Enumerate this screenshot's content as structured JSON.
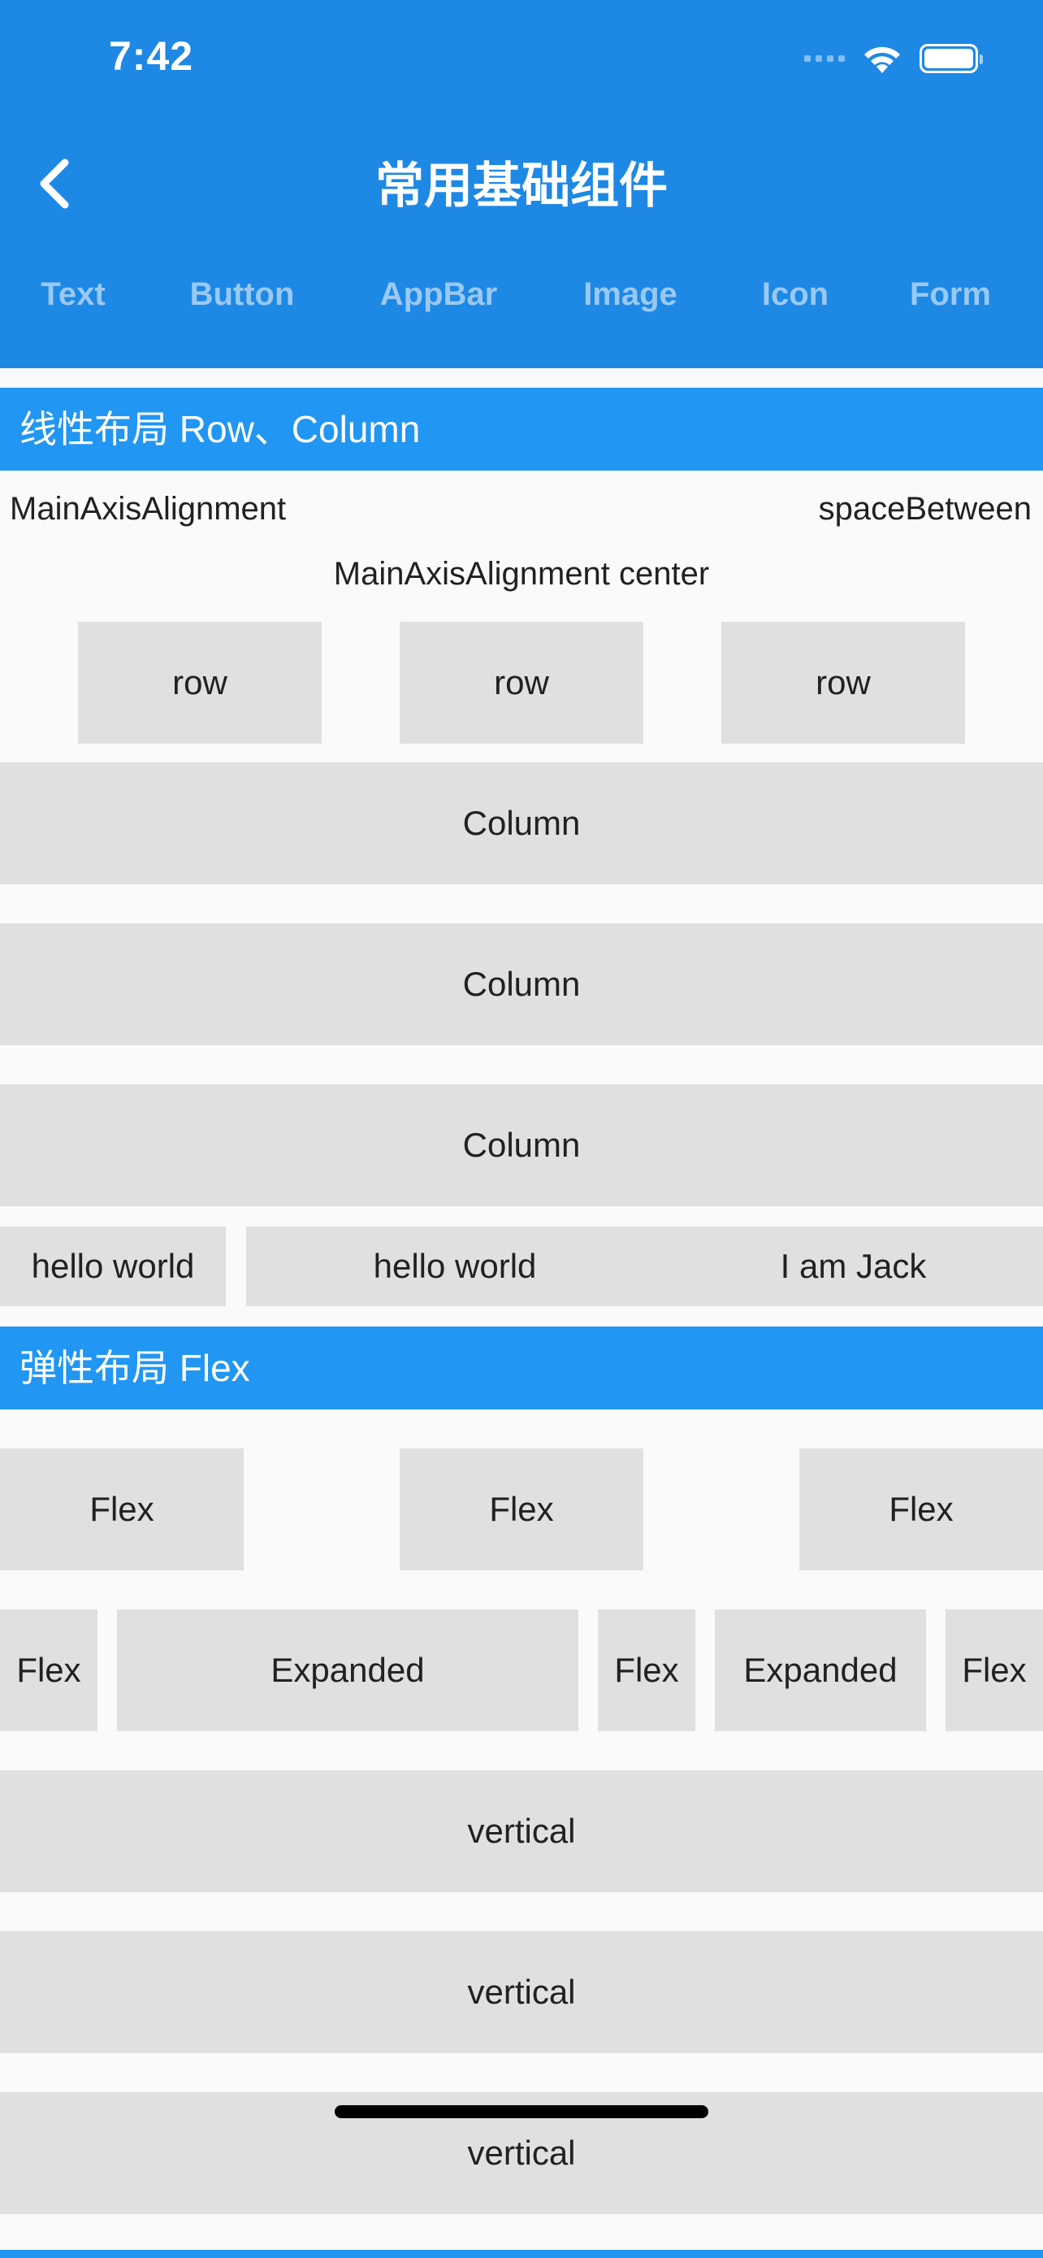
{
  "status_bar": {
    "time": "7:42"
  },
  "header": {
    "title": "常用基础组件",
    "tabs": [
      "Text",
      "Button",
      "AppBar",
      "Image",
      "Icon",
      "Form"
    ]
  },
  "linear": {
    "section_title": "线性布局 Row、Column",
    "space_between_left": "MainAxisAlignment",
    "space_between_right": "spaceBetween",
    "center_label": "MainAxisAlignment  center",
    "rows": [
      "row",
      "row",
      "row"
    ],
    "columns": [
      "Column",
      "Column",
      "Column"
    ],
    "hello_row": [
      "hello world",
      "hello world",
      "I am Jack"
    ]
  },
  "flex": {
    "section_title": "弹性布局 Flex",
    "row1": [
      "Flex",
      "Flex",
      "Flex"
    ],
    "row2": [
      "Flex",
      "Expanded",
      "Flex",
      "Expanded",
      "Flex"
    ],
    "verticals": [
      "vertical",
      "vertical",
      "vertical"
    ]
  }
}
